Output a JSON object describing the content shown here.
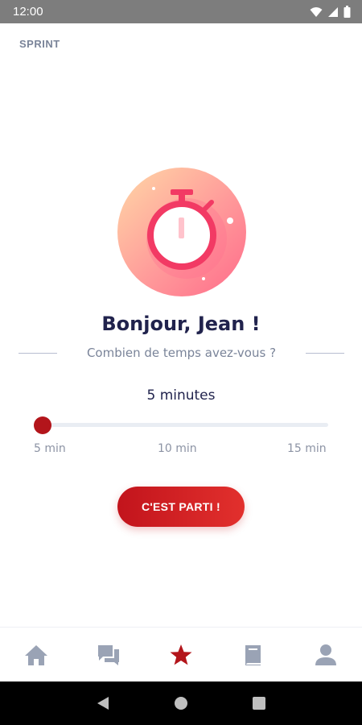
{
  "status_bar": {
    "time": "12:00"
  },
  "screen_label": "SPRINT",
  "greeting": "Bonjour, Jean !",
  "question": "Combien de temps avez-vous ?",
  "slider": {
    "value_text": "5 minutes",
    "value_minutes": 5,
    "min_label": "5 min",
    "mid_label": "10 min",
    "max_label": "15 min"
  },
  "start_button": {
    "label": "C'EST PARTI !"
  },
  "bottom_nav": {
    "items": [
      {
        "icon": "home-icon"
      },
      {
        "icon": "chat-icon"
      },
      {
        "icon": "star-icon",
        "active": true
      },
      {
        "icon": "book-icon"
      },
      {
        "icon": "profile-icon"
      }
    ]
  },
  "colors": {
    "accent": "#b3151b",
    "title": "#21234d",
    "muted": "#7a8499",
    "nav_inactive": "#9aa3b5"
  }
}
